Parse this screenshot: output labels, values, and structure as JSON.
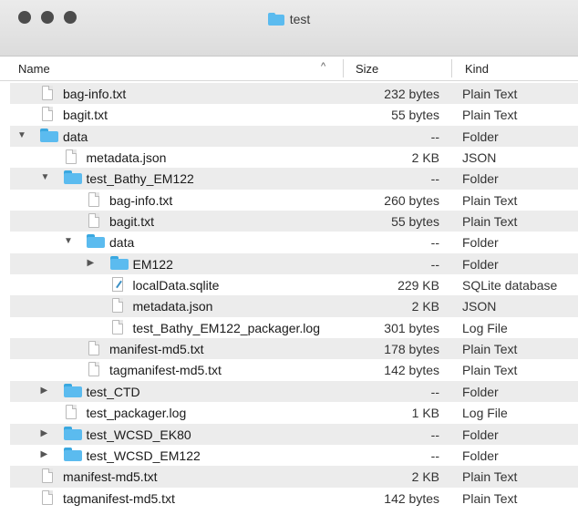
{
  "window": {
    "title": "test"
  },
  "columns": {
    "name": "Name",
    "size": "Size",
    "kind": "Kind",
    "sort_indicator": "^"
  },
  "rows": [
    {
      "name": "bag-info.txt",
      "size": "232 bytes",
      "kind": "Plain Text",
      "type": "file",
      "depth": 0,
      "icon": "document-icon"
    },
    {
      "name": "bagit.txt",
      "size": "55 bytes",
      "kind": "Plain Text",
      "type": "file",
      "depth": 0,
      "icon": "document-icon"
    },
    {
      "name": "data",
      "size": "--",
      "kind": "Folder",
      "type": "folder",
      "depth": 0,
      "expanded": true,
      "icon": "folder-icon"
    },
    {
      "name": "metadata.json",
      "size": "2 KB",
      "kind": "JSON",
      "type": "file",
      "depth": 1,
      "icon": "document-icon"
    },
    {
      "name": "test_Bathy_EM122",
      "size": "--",
      "kind": "Folder",
      "type": "folder",
      "depth": 1,
      "expanded": true,
      "icon": "folder-icon"
    },
    {
      "name": "bag-info.txt",
      "size": "260 bytes",
      "kind": "Plain Text",
      "type": "file",
      "depth": 2,
      "icon": "document-icon"
    },
    {
      "name": "bagit.txt",
      "size": "55 bytes",
      "kind": "Plain Text",
      "type": "file",
      "depth": 2,
      "icon": "document-icon"
    },
    {
      "name": "data",
      "size": "--",
      "kind": "Folder",
      "type": "folder",
      "depth": 2,
      "expanded": true,
      "icon": "folder-icon"
    },
    {
      "name": "EM122",
      "size": "--",
      "kind": "Folder",
      "type": "folder",
      "depth": 3,
      "expanded": false,
      "icon": "folder-icon"
    },
    {
      "name": "localData.sqlite",
      "size": "229 KB",
      "kind": "SQLite database",
      "type": "file",
      "depth": 3,
      "icon": "sqlite-icon"
    },
    {
      "name": "metadata.json",
      "size": "2 KB",
      "kind": "JSON",
      "type": "file",
      "depth": 3,
      "icon": "document-icon"
    },
    {
      "name": "test_Bathy_EM122_packager.log",
      "size": "301 bytes",
      "kind": "Log File",
      "type": "file",
      "depth": 3,
      "icon": "document-icon"
    },
    {
      "name": "manifest-md5.txt",
      "size": "178 bytes",
      "kind": "Plain Text",
      "type": "file",
      "depth": 2,
      "icon": "document-icon"
    },
    {
      "name": "tagmanifest-md5.txt",
      "size": "142 bytes",
      "kind": "Plain Text",
      "type": "file",
      "depth": 2,
      "icon": "document-icon"
    },
    {
      "name": "test_CTD",
      "size": "--",
      "kind": "Folder",
      "type": "folder",
      "depth": 1,
      "expanded": false,
      "icon": "folder-icon"
    },
    {
      "name": "test_packager.log",
      "size": "1 KB",
      "kind": "Log File",
      "type": "file",
      "depth": 1,
      "icon": "document-icon"
    },
    {
      "name": "test_WCSD_EK80",
      "size": "--",
      "kind": "Folder",
      "type": "folder",
      "depth": 1,
      "expanded": false,
      "icon": "folder-icon"
    },
    {
      "name": "test_WCSD_EM122",
      "size": "--",
      "kind": "Folder",
      "type": "folder",
      "depth": 1,
      "expanded": false,
      "icon": "folder-icon"
    },
    {
      "name": "manifest-md5.txt",
      "size": "2 KB",
      "kind": "Plain Text",
      "type": "file",
      "depth": 0,
      "icon": "document-icon"
    },
    {
      "name": "tagmanifest-md5.txt",
      "size": "142 bytes",
      "kind": "Plain Text",
      "type": "file",
      "depth": 0,
      "icon": "document-icon"
    }
  ]
}
